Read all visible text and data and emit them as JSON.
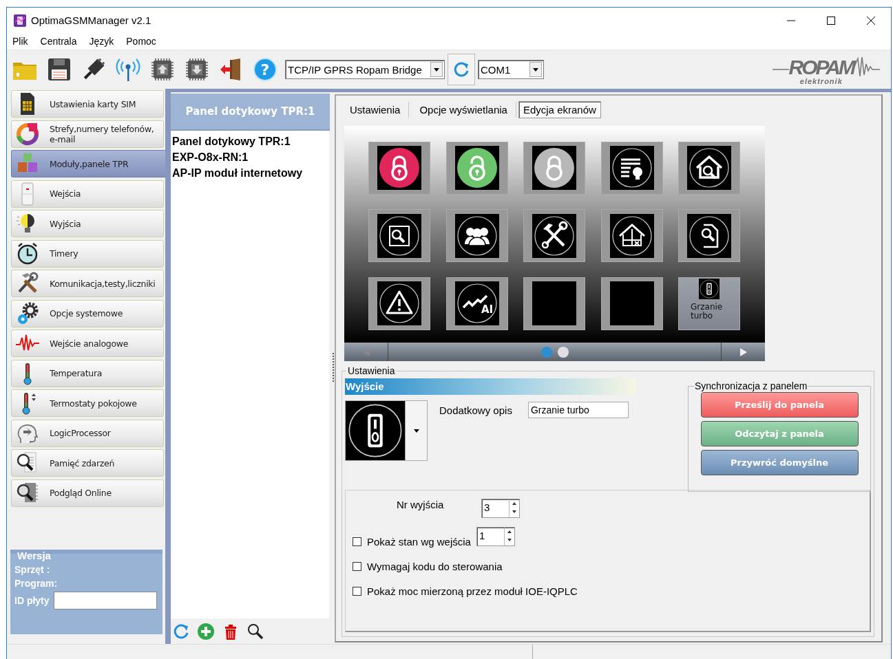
{
  "window": {
    "title": "OptimaGSMManager v2.1"
  },
  "menu": [
    {
      "label": "Plik"
    },
    {
      "label": "Centrala"
    },
    {
      "label": "Język"
    },
    {
      "label": "Pomoc"
    }
  ],
  "toolbar": {
    "buttons": [
      {
        "kind": "folder"
      },
      {
        "kind": "save"
      },
      {
        "kind": "plug"
      },
      {
        "kind": "antenna"
      },
      {
        "kind": "chip_up"
      },
      {
        "kind": "chip_down"
      },
      {
        "kind": "exit"
      }
    ],
    "help_label": "?",
    "connection": "TCP/IP GPRS Ropam Bridge",
    "port": "COM1"
  },
  "logo": {
    "name": "ROPAM",
    "subtitle": "elektronik"
  },
  "sidebar": {
    "items": [
      {
        "label": "Ustawienia karty SIM",
        "kind": "sim",
        "selected": false
      },
      {
        "label": "Strefy,numery telefonów, e-mail",
        "kind": "zones",
        "selected": false
      },
      {
        "label": "Moduły,panele TPR",
        "kind": "modules",
        "selected": true
      },
      {
        "label": "Wejścia",
        "kind": "inputs",
        "selected": false
      },
      {
        "label": "Wyjścia",
        "kind": "outputs",
        "selected": false
      },
      {
        "label": "Timery",
        "kind": "timers",
        "selected": false
      },
      {
        "label": "Komunikacja,testy,liczniki",
        "kind": "tools",
        "selected": false
      },
      {
        "label": "Opcje systemowe",
        "kind": "gears",
        "selected": false
      },
      {
        "label": "Wejście analogowe",
        "kind": "analog",
        "selected": false
      },
      {
        "label": "Temperatura",
        "kind": "thermo",
        "selected": false
      },
      {
        "label": "Termostaty pokojowe",
        "kind": "thermostat",
        "selected": false
      },
      {
        "label": "LogicProcessor",
        "kind": "logic",
        "selected": false
      },
      {
        "label": "Pamięć zdarzeń",
        "kind": "events",
        "selected": false
      },
      {
        "label": "Podgląd Online",
        "kind": "online",
        "selected": false
      }
    ],
    "version": {
      "title": "Wersja",
      "hardware_label": "Sprzęt :",
      "program_label": "Program:",
      "board_id_label": "ID płyty"
    }
  },
  "modules": {
    "header": "Panel dotykowy TPR:1",
    "items": [
      {
        "label": "Panel dotykowy TPR:1"
      },
      {
        "label": "EXP-O8x-RN:1"
      },
      {
        "label": "AP-IP moduł internetowy"
      }
    ]
  },
  "tabs": [
    {
      "label": "Ustawienia",
      "selected": false
    },
    {
      "label": "Opcje wyświetlania",
      "selected": false
    },
    {
      "label": "Edycja ekranów",
      "selected": true
    }
  ],
  "screen": {
    "tiles": [
      {
        "kind": "lock_red",
        "selected": false
      },
      {
        "kind": "lock_green",
        "selected": false
      },
      {
        "kind": "lock_gray",
        "selected": false
      },
      {
        "kind": "lights",
        "selected": false
      },
      {
        "kind": "home_search",
        "selected": false
      },
      {
        "kind": "plan_search",
        "selected": false
      },
      {
        "kind": "users",
        "selected": false
      },
      {
        "kind": "tools",
        "selected": false
      },
      {
        "kind": "home_zones",
        "selected": false
      },
      {
        "kind": "doc_search",
        "selected": false
      },
      {
        "kind": "warning",
        "selected": false
      },
      {
        "kind": "analog",
        "icon_text": "AI",
        "selected": false
      },
      {
        "kind": "empty",
        "selected": false
      },
      {
        "kind": "empty",
        "selected": false
      },
      {
        "kind": "switch",
        "label": "Grzanie turbo",
        "selected": true
      }
    ],
    "pages": [
      {
        "selected": true
      },
      {
        "selected": false
      }
    ]
  },
  "settings": {
    "title": "Ustawienia",
    "section": "Wyjście",
    "description_label": "Dodatkowy opis",
    "description": "Grzanie turbo",
    "sync": {
      "title": "Synchronizacja z panelem",
      "buttons": [
        {
          "label": "Prześlij do panela",
          "kind": "send"
        },
        {
          "label": "Odczytaj z panela",
          "kind": "read"
        },
        {
          "label": "Przywróć domyślne",
          "kind": "reset"
        }
      ]
    },
    "output_number_label": "Nr wyjścia",
    "output_number": "3",
    "options": [
      {
        "label": "Pokaż stan wg wejścia",
        "checked": false,
        "input": "1"
      },
      {
        "label": "Wymagaj kodu do sterowania",
        "checked": false
      },
      {
        "label": "Pokaż moc mierzoną przez moduł IOE-IQPLC",
        "checked": false
      }
    ]
  }
}
